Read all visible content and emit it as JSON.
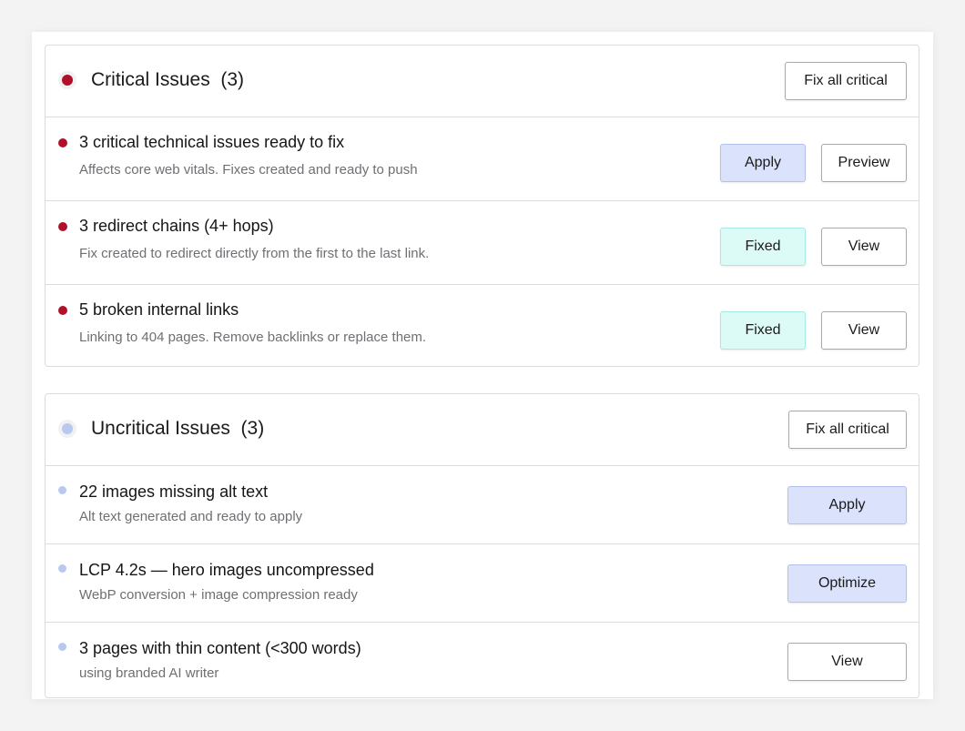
{
  "colors": {
    "critical_dot": "#b0102a",
    "uncritical_dot": "#b9c8ef",
    "apply_bg": "#dbe2fb",
    "fixed_bg": "#dcfaf6"
  },
  "critical": {
    "title": "Critical Issues  (3)",
    "action_label": "Fix all critical",
    "rows": [
      {
        "title": "3 critical technical issues ready to fix",
        "subtitle": "Affects core web vitals. Fixes created and ready to push",
        "primary_label": "Apply",
        "secondary_label": "Preview"
      },
      {
        "title": "3 redirect chains (4+ hops)",
        "subtitle": "Fix created to redirect directly from the first to the last link.",
        "primary_label": "Fixed",
        "secondary_label": "View"
      },
      {
        "title": "5 broken internal links",
        "subtitle": "Linking to 404 pages. Remove backlinks or replace them.",
        "primary_label": "Fixed",
        "secondary_label": "View"
      }
    ]
  },
  "uncritical": {
    "title": "Uncritical Issues  (3)",
    "action_label": "Fix all critical",
    "rows": [
      {
        "title": "22 images missing alt text",
        "subtitle": "Alt text generated and ready to apply",
        "action_label": "Apply"
      },
      {
        "title": "LCP 4.2s — hero images uncompressed",
        "subtitle": "WebP conversion + image compression ready",
        "action_label": "Optimize"
      },
      {
        "title": "3 pages with thin content (<300 words)",
        "subtitle": "using branded AI writer",
        "action_label": "View"
      }
    ]
  }
}
